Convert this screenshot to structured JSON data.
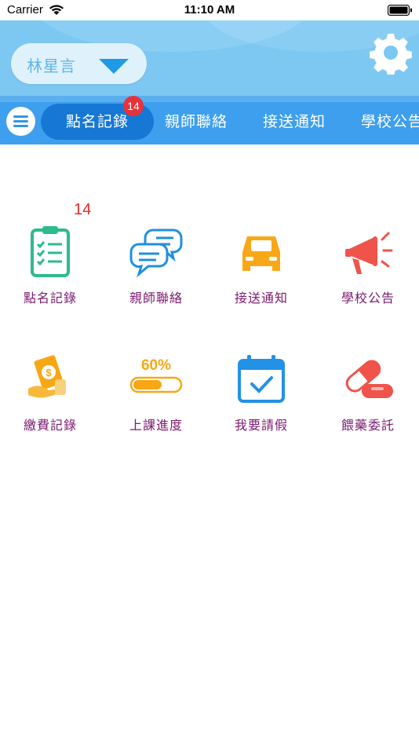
{
  "status_bar": {
    "carrier": "Carrier",
    "time": "11:10 AM"
  },
  "header": {
    "student_name": "林星言"
  },
  "tabs": [
    {
      "label": "點名記錄",
      "active": true,
      "badge": "14"
    },
    {
      "label": "親師聯絡"
    },
    {
      "label": "接送通知"
    },
    {
      "label": "學校公告"
    }
  ],
  "grid": {
    "badge": "14",
    "items": [
      {
        "label": "點名記錄",
        "icon": "attendance-clipboard-icon"
      },
      {
        "label": "親師聯絡",
        "icon": "chat-bubbles-icon"
      },
      {
        "label": "接送通知",
        "icon": "car-icon"
      },
      {
        "label": "學校公告",
        "icon": "megaphone-icon"
      },
      {
        "label": "繳費記錄",
        "icon": "payment-icon"
      },
      {
        "label": "上課進度",
        "icon": "progress-icon",
        "progress_text": "60%"
      },
      {
        "label": "我要請假",
        "icon": "calendar-check-icon"
      },
      {
        "label": "餵藥委託",
        "icon": "medicine-capsule-icon"
      }
    ]
  },
  "colors": {
    "header_bg": "#7cc8f2",
    "tabbar_bg": "#3d9fed",
    "active_tab": "#1678d4",
    "badge": "#e6333a",
    "label_text": "#7a1a6e"
  }
}
